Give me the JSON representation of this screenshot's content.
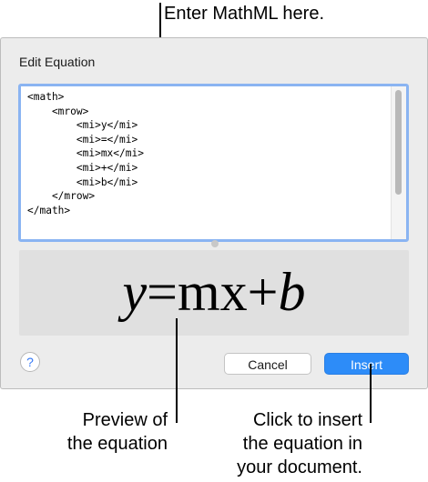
{
  "callouts": {
    "mathml": "Enter MathML here.",
    "preview_line1": "Preview of",
    "preview_line2": "the equation",
    "insert_line1": "Click to insert",
    "insert_line2": "the equation in",
    "insert_line3": "your document."
  },
  "dialog": {
    "title": "Edit Equation",
    "editor_lines": [
      "<math>",
      "    <mrow>",
      "        <mi>y</mi>",
      "        <mi>=</mi>",
      "        <mi>mx</mi>",
      "        <mi>+</mi>",
      "        <mi>b</mi>",
      "    </mrow>",
      "</math>"
    ],
    "preview": {
      "y": "y",
      "eq": "=",
      "mx": "mx",
      "plus": "+",
      "b": "b"
    },
    "help_label": "?",
    "cancel_label": "Cancel",
    "insert_label": "Insert"
  },
  "colors": {
    "accent": "#2d8cf8",
    "focus_ring": "#8ab4f2",
    "dialog_bg": "#ececec",
    "preview_bg": "#e0e0e0"
  }
}
